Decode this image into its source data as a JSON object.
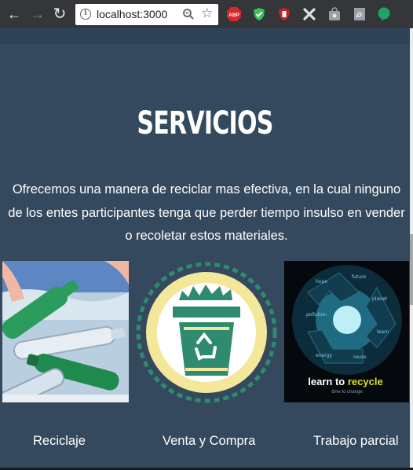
{
  "browser": {
    "url": "localhost:3000"
  },
  "section": {
    "title": "SERVICIOS",
    "description": "Ofrecemos una manera de reciclar mas efectiva, en la cual ninguno de los entes participantes tenga que perder tiempo insulso en vender o recoletar estos materiales."
  },
  "services": [
    {
      "label": "Reciclaje",
      "icon": "bottles-photo"
    },
    {
      "label": "Venta y Compra",
      "icon": "recycle-bin-icon"
    },
    {
      "label": "Trabajo parcial",
      "icon": "recycle-poster"
    }
  ],
  "poster": {
    "headline_a": "learn to ",
    "headline_b": "recycle",
    "tagline": "time to change"
  },
  "colors": {
    "page_bg": "#35495e",
    "bin_green": "#2e8b6f",
    "bin_circle": "#f3e79a",
    "poster_yellow": "#d9e021"
  }
}
